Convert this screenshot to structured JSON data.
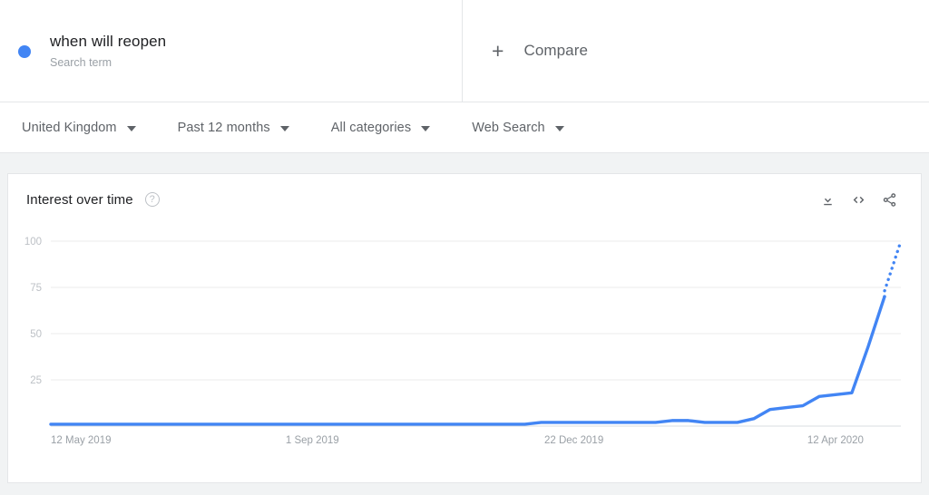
{
  "terms": [
    {
      "title": "when will reopen",
      "subtitle": "Search term",
      "color": "#4285f4",
      "dot_name": "series-color-dot"
    }
  ],
  "compare": {
    "plus": "+",
    "label": "Compare"
  },
  "filters": [
    {
      "label": "United Kingdom",
      "name": "location"
    },
    {
      "label": "Past 12 months",
      "name": "time-range"
    },
    {
      "label": "All categories",
      "name": "category"
    },
    {
      "label": "Web Search",
      "name": "search-type"
    }
  ],
  "chart_panel": {
    "title": "Interest over time",
    "help_icon": "?",
    "actions": [
      {
        "name": "download-icon",
        "label": "Download"
      },
      {
        "name": "embed-icon",
        "label": "Embed"
      },
      {
        "name": "share-icon",
        "label": "Share"
      }
    ]
  },
  "chart_data": {
    "type": "line",
    "title": "Interest over time",
    "xlabel": "",
    "ylabel": "",
    "ylim": [
      0,
      100
    ],
    "yticks": [
      25,
      50,
      75,
      100
    ],
    "ytick_labels": [
      "25",
      "50",
      "75",
      "100"
    ],
    "grid": true,
    "legend_position": "top",
    "line_color": "#4285f4",
    "xtick_labels": [
      "12 May 2019",
      "1 Sep 2019",
      "22 Dec 2019",
      "12 Apr 2020"
    ],
    "xtick_positions": [
      0,
      16,
      32,
      48
    ],
    "series": [
      {
        "name": "when will reopen",
        "x": [
          0,
          1,
          2,
          3,
          4,
          5,
          6,
          7,
          8,
          9,
          10,
          11,
          12,
          13,
          14,
          15,
          16,
          17,
          18,
          19,
          20,
          21,
          22,
          23,
          24,
          25,
          26,
          27,
          28,
          29,
          30,
          31,
          32,
          33,
          34,
          35,
          36,
          37,
          38,
          39,
          40,
          41,
          42,
          43,
          44,
          45,
          46,
          47,
          48,
          49,
          50,
          51
        ],
        "values": [
          1,
          1,
          1,
          1,
          1,
          1,
          1,
          1,
          1,
          1,
          1,
          1,
          1,
          1,
          1,
          1,
          1,
          1,
          1,
          1,
          1,
          1,
          1,
          1,
          1,
          1,
          1,
          1,
          1,
          1,
          2,
          2,
          2,
          2,
          2,
          2,
          2,
          2,
          3,
          3,
          2,
          2,
          2,
          4,
          9,
          10,
          11,
          16,
          17,
          18,
          43,
          70
        ],
        "partial_from_index": 51,
        "partial_x": [
          51,
          52
        ],
        "partial_values": [
          73,
          100
        ]
      }
    ]
  }
}
